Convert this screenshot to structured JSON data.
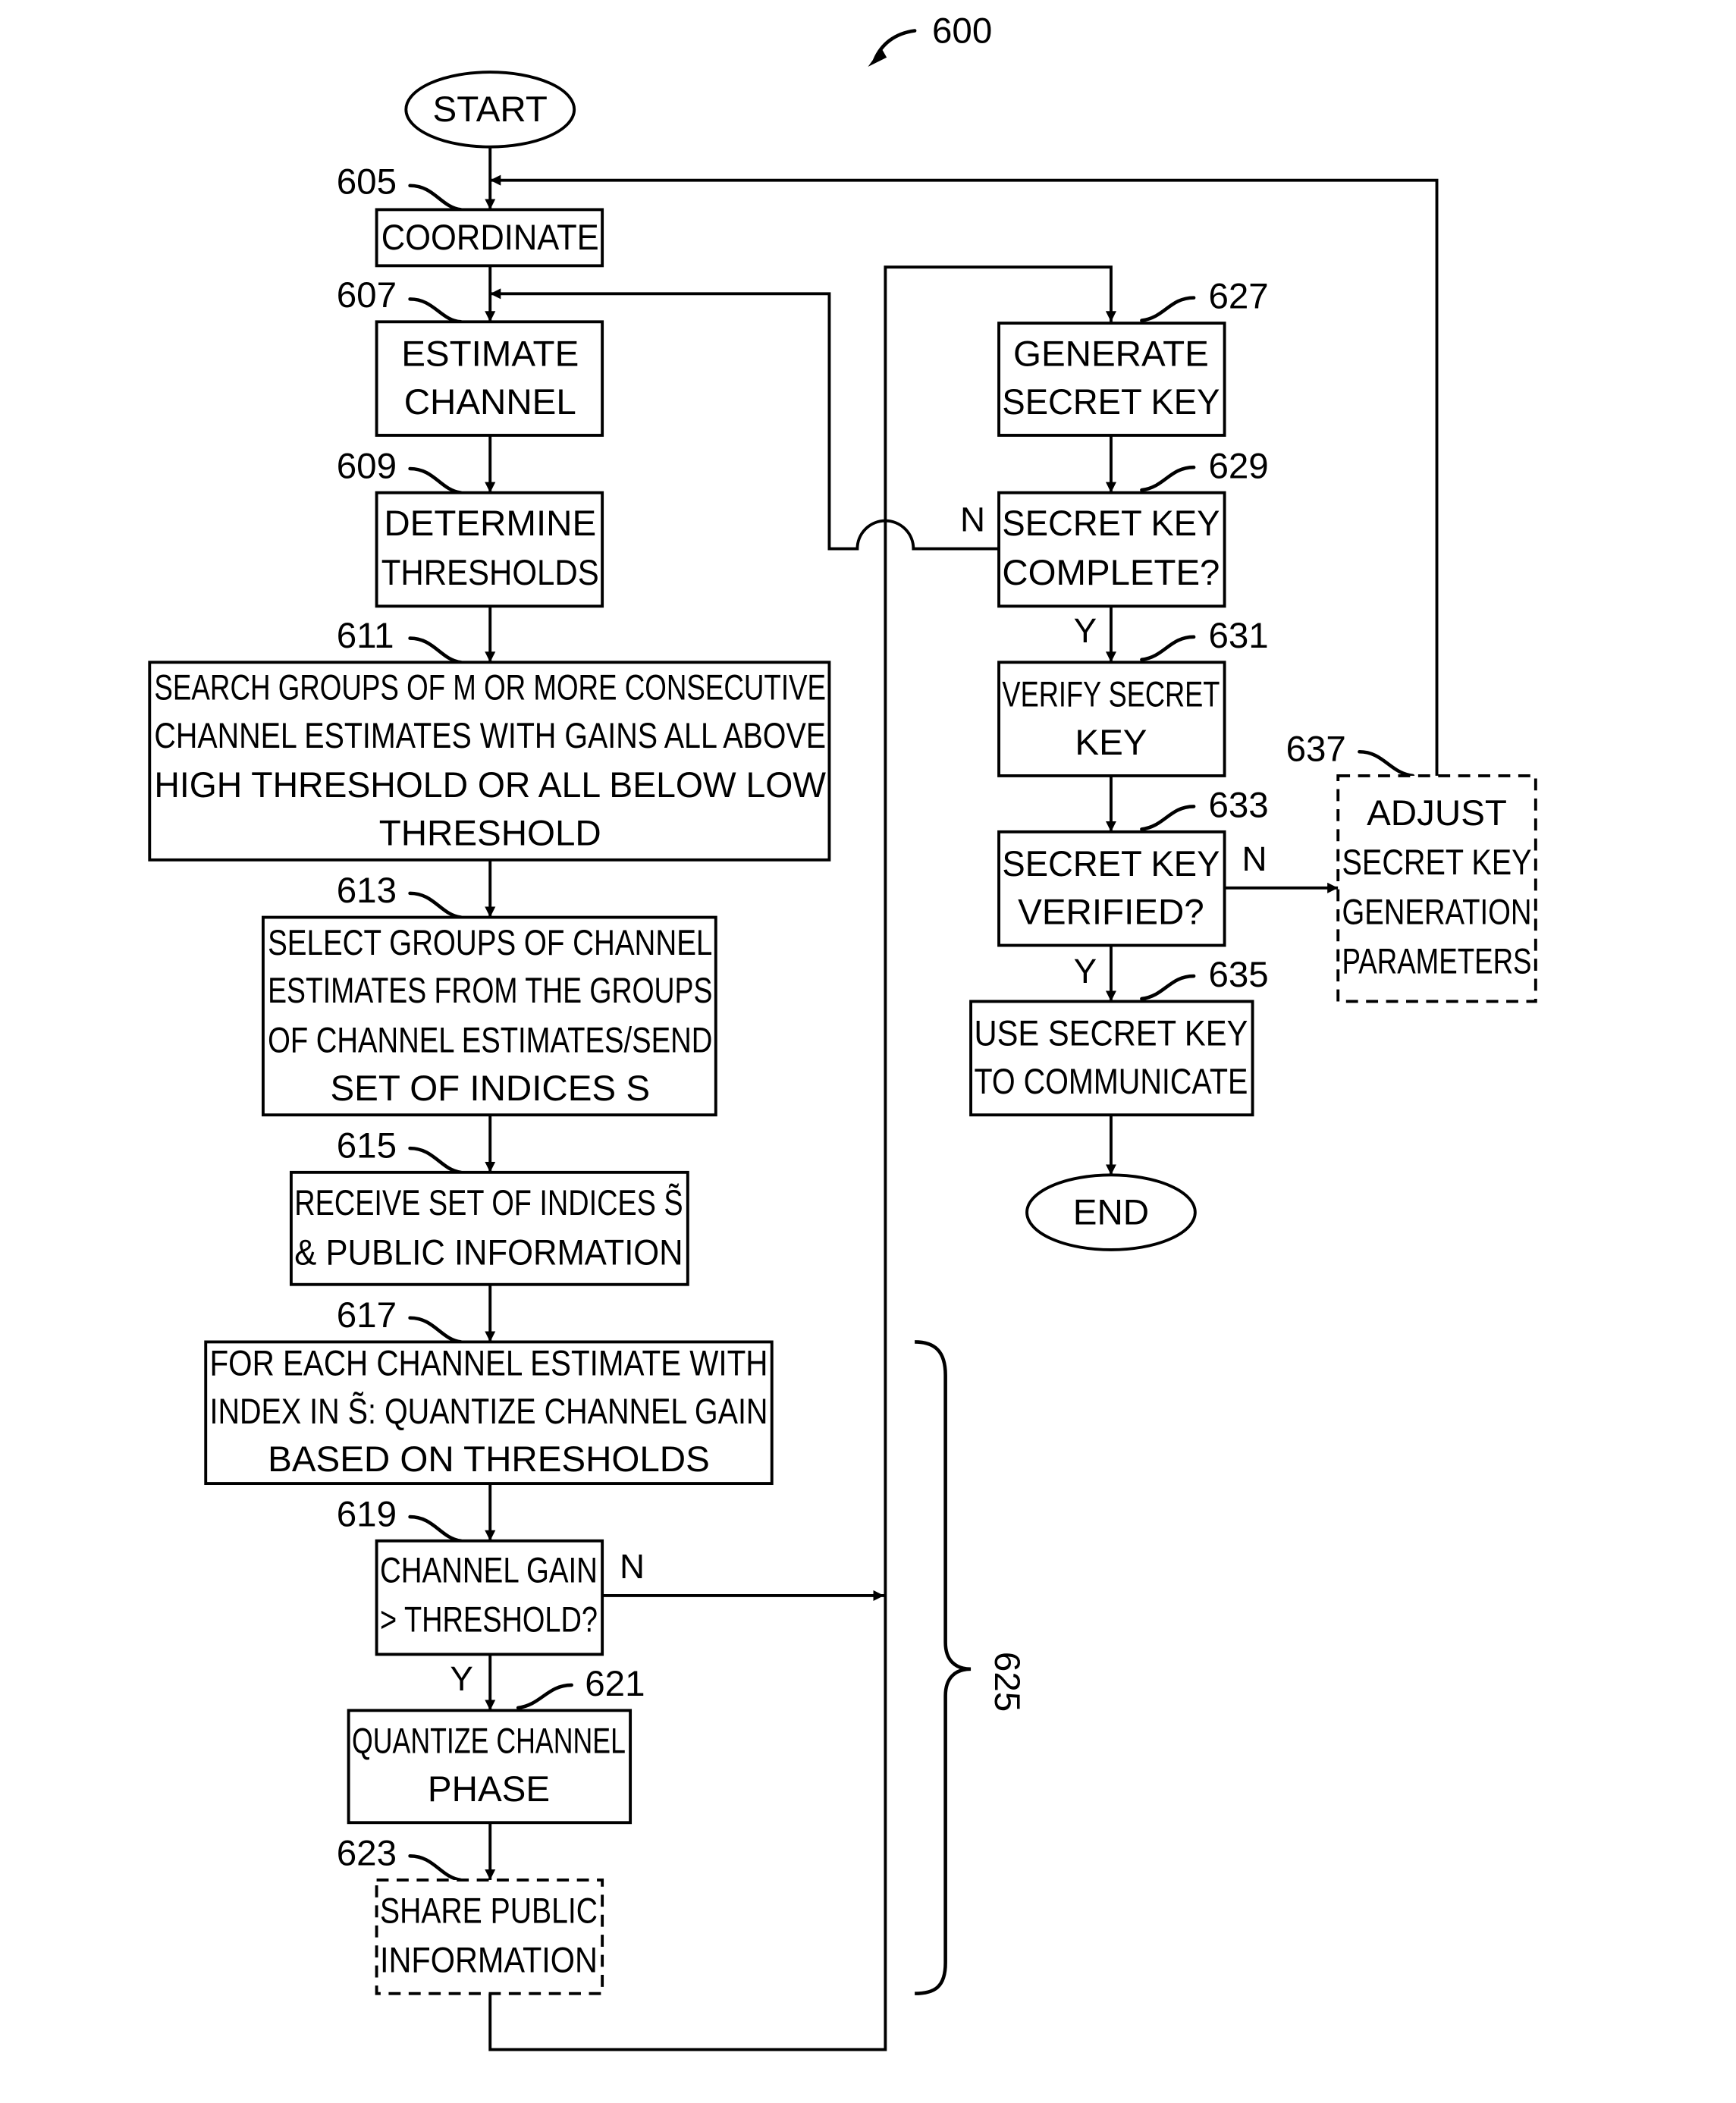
{
  "figure": {
    "ref": "600",
    "bracket_ref": "625"
  },
  "terminals": {
    "start": "START",
    "end": "END"
  },
  "steps": {
    "s605": {
      "ref": "605",
      "lines": [
        "COORDINATE"
      ]
    },
    "s607": {
      "ref": "607",
      "lines": [
        "ESTIMATE",
        "CHANNEL"
      ]
    },
    "s609": {
      "ref": "609",
      "lines": [
        "DETERMINE",
        "THRESHOLDS"
      ]
    },
    "s611": {
      "ref": "611",
      "lines": [
        "SEARCH GROUPS OF M OR MORE CONSECUTIVE",
        "CHANNEL ESTIMATES WITH GAINS ALL ABOVE",
        "HIGH THRESHOLD OR ALL BELOW LOW",
        "THRESHOLD"
      ]
    },
    "s613": {
      "ref": "613",
      "lines": [
        "SELECT GROUPS OF CHANNEL",
        "ESTIMATES FROM THE GROUPS",
        "OF CHANNEL ESTIMATES/SEND",
        "SET OF INDICES S"
      ]
    },
    "s615": {
      "ref": "615",
      "lines": [
        "RECEIVE SET OF INDICES S̃",
        "& PUBLIC INFORMATION"
      ]
    },
    "s617": {
      "ref": "617",
      "lines": [
        "FOR EACH CHANNEL ESTIMATE WITH",
        "INDEX IN S̃: QUANTIZE CHANNEL GAIN",
        "BASED ON THRESHOLDS"
      ]
    },
    "s619": {
      "ref": "619",
      "lines": [
        "CHANNEL GAIN",
        "> THRESHOLD?"
      ]
    },
    "s621": {
      "ref": "621",
      "lines": [
        "QUANTIZE CHANNEL",
        "PHASE"
      ]
    },
    "s623": {
      "ref": "623",
      "lines": [
        "SHARE PUBLIC",
        "INFORMATION"
      ]
    },
    "s627": {
      "ref": "627",
      "lines": [
        "GENERATE",
        "SECRET KEY"
      ]
    },
    "s629": {
      "ref": "629",
      "lines": [
        "SECRET KEY",
        "COMPLETE?"
      ]
    },
    "s631": {
      "ref": "631",
      "lines": [
        "VERIFY SECRET",
        "KEY"
      ]
    },
    "s633": {
      "ref": "633",
      "lines": [
        "SECRET KEY",
        "VERIFIED?"
      ]
    },
    "s635": {
      "ref": "635",
      "lines": [
        "USE SECRET KEY",
        "TO COMMUNICATE"
      ]
    },
    "s637": {
      "ref": "637",
      "lines": [
        "ADJUST",
        "SECRET KEY",
        "GENERATION",
        "PARAMETERS"
      ]
    }
  },
  "branch_labels": {
    "n619": "N",
    "y619": "Y",
    "n629": "N",
    "y629": "Y",
    "n633": "N",
    "y633": "Y"
  }
}
